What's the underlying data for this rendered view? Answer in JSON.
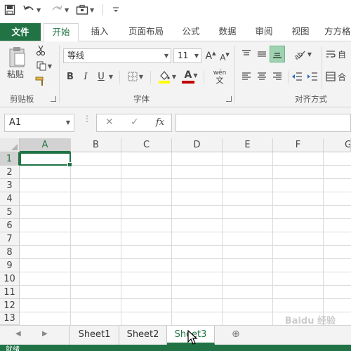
{
  "tabs": {
    "file": "文件",
    "home": "开始",
    "insert": "插入",
    "page_layout": "页面布局",
    "formulas": "公式",
    "data": "数据",
    "review": "审阅",
    "view": "视图",
    "more": "方方格"
  },
  "ribbon": {
    "paste_label": "粘贴",
    "clipboard_label": "剪贴板",
    "font_name": "等线",
    "font_size": "11",
    "font_group_label": "字体",
    "align_group_label": "对齐方式",
    "wrap_label": "自",
    "merge_label": "合",
    "bold": "B",
    "italic": "I",
    "underline": "U",
    "grow_font": "A",
    "shrink_font": "A",
    "font_color": "A",
    "phonetic_top": "wén",
    "phonetic_bottom": "文"
  },
  "formula_bar": {
    "name_box": "A1",
    "cancel": "✕",
    "enter": "✓",
    "fx": "fx",
    "formula": ""
  },
  "grid": {
    "columns": [
      "A",
      "B",
      "C",
      "D",
      "E",
      "F",
      "G"
    ],
    "rows": [
      "1",
      "2",
      "3",
      "4",
      "5",
      "6",
      "7",
      "8",
      "9",
      "10",
      "11",
      "12",
      "13"
    ],
    "active_cell": "A1"
  },
  "sheets": {
    "tabs": [
      "Sheet1",
      "Sheet2",
      "Sheet3"
    ],
    "active": "Sheet3"
  },
  "status": {
    "text": "就绪"
  },
  "watermark": "Baidu 经验",
  "colors": {
    "accent": "#217346",
    "ribbon_bg": "#f3f3f3",
    "font_color_bar": "#c00000",
    "fill_color_bar": "#ffff00"
  }
}
